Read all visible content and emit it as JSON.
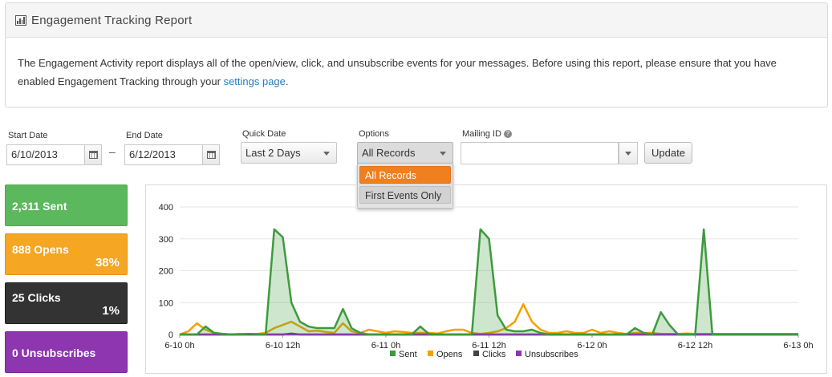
{
  "header": {
    "title": "Engagement Tracking Report",
    "description": "The Engagement Activity report displays all of the open/view, click, and unsubscribe events for your messages. Before using this report, please ensure that you have enabled Engagement Tracking through your ",
    "link_text": "settings page",
    "description_end": "."
  },
  "filters": {
    "start_date_label": "Start Date",
    "start_date_value": "6/10/2013",
    "date_separator": "–",
    "end_date_label": "End Date",
    "end_date_value": "6/12/2013",
    "quick_date_label": "Quick Date",
    "quick_date_value": "Last 2 Days",
    "options_label": "Options",
    "options_value": "All Records",
    "options_items": [
      "All Records",
      "First Events Only"
    ],
    "mailing_id_label": "Mailing ID",
    "mailing_id_help": "?",
    "update_label": "Update"
  },
  "stats": [
    {
      "label": "2,311 Sent",
      "percent": "",
      "color": "#5cb85c"
    },
    {
      "label": "888 Opens",
      "percent": "38%",
      "color": "#f5a623"
    },
    {
      "label": "25 Clicks",
      "percent": "1%",
      "color": "#333333"
    },
    {
      "label": "0 Unsubscribes",
      "percent": "",
      "color": "#8e35b0"
    }
  ],
  "chart_data": {
    "type": "area",
    "x": [
      "6-10 0h",
      "6-10 1h",
      "6-10 2h",
      "6-10 3h",
      "6-10 4h",
      "6-10 5h",
      "6-10 6h",
      "6-10 7h",
      "6-10 8h",
      "6-10 9h",
      "6-10 10h",
      "6-10 11h",
      "6-10 12h",
      "6-10 13h",
      "6-10 14h",
      "6-10 15h",
      "6-10 16h",
      "6-10 17h",
      "6-10 18h",
      "6-10 19h",
      "6-10 20h",
      "6-10 21h",
      "6-10 22h",
      "6-10 23h",
      "6-11 0h",
      "6-11 1h",
      "6-11 2h",
      "6-11 3h",
      "6-11 4h",
      "6-11 5h",
      "6-11 6h",
      "6-11 7h",
      "6-11 8h",
      "6-11 9h",
      "6-11 10h",
      "6-11 11h",
      "6-11 12h",
      "6-11 13h",
      "6-11 14h",
      "6-11 15h",
      "6-11 16h",
      "6-11 17h",
      "6-11 18h",
      "6-11 19h",
      "6-11 20h",
      "6-11 21h",
      "6-11 22h",
      "6-11 23h",
      "6-12 0h",
      "6-12 1h",
      "6-12 2h",
      "6-12 3h",
      "6-12 4h",
      "6-12 5h",
      "6-12 6h",
      "6-12 7h",
      "6-12 8h",
      "6-12 9h",
      "6-12 10h",
      "6-12 11h",
      "6-12 12h",
      "6-12 13h",
      "6-12 14h",
      "6-12 15h",
      "6-12 16h",
      "6-12 17h",
      "6-12 18h",
      "6-12 19h",
      "6-12 20h",
      "6-12 21h",
      "6-12 22h",
      "6-12 23h",
      "6-13 0h"
    ],
    "tick_labels": [
      "6-10 0h",
      "6-10 12h",
      "6-11 0h",
      "6-11 12h",
      "6-12 0h",
      "6-12 12h",
      "6-13 0h"
    ],
    "series": [
      {
        "name": "Sent",
        "color": "#3d9a3d",
        "values": [
          0,
          0,
          0,
          25,
          5,
          2,
          0,
          0,
          2,
          1,
          0,
          330,
          305,
          100,
          40,
          25,
          20,
          20,
          20,
          80,
          20,
          5,
          0,
          0,
          0,
          0,
          0,
          0,
          25,
          2,
          0,
          0,
          0,
          0,
          0,
          330,
          300,
          60,
          15,
          10,
          10,
          15,
          5,
          0,
          0,
          0,
          0,
          0,
          0,
          0,
          0,
          0,
          0,
          20,
          5,
          0,
          70,
          30,
          0,
          0,
          0,
          330,
          0,
          0,
          0,
          0,
          0,
          0,
          0,
          0,
          0,
          0,
          0
        ]
      },
      {
        "name": "Opens",
        "color": "#f5a000",
        "values": [
          0,
          10,
          35,
          15,
          5,
          2,
          0,
          2,
          2,
          2,
          5,
          20,
          30,
          40,
          25,
          10,
          12,
          8,
          5,
          35,
          10,
          5,
          15,
          10,
          5,
          10,
          8,
          5,
          5,
          5,
          3,
          10,
          15,
          15,
          5,
          2,
          5,
          10,
          20,
          40,
          95,
          40,
          15,
          5,
          5,
          10,
          5,
          5,
          15,
          5,
          10,
          5,
          2,
          5,
          5,
          5,
          2,
          2,
          2,
          3,
          2,
          2,
          2,
          2,
          2,
          2,
          2,
          2,
          2,
          2,
          2,
          2,
          2
        ]
      },
      {
        "name": "Clicks",
        "color": "#444444",
        "values": [
          0,
          0,
          0,
          0,
          0,
          0,
          0,
          0,
          0,
          0,
          0,
          0,
          0,
          3,
          0,
          0,
          0,
          0,
          0,
          0,
          0,
          0,
          0,
          0,
          0,
          0,
          0,
          0,
          0,
          0,
          0,
          0,
          0,
          0,
          0,
          0,
          0,
          0,
          0,
          0,
          0,
          0,
          0,
          0,
          0,
          0,
          0,
          0,
          0,
          0,
          0,
          0,
          0,
          0,
          0,
          0,
          0,
          0,
          0,
          0,
          0,
          0,
          0,
          0,
          0,
          0,
          0,
          0,
          0,
          0,
          0,
          0,
          0
        ]
      },
      {
        "name": "Unsubscribes",
        "color": "#8e35b0",
        "values": [
          0,
          0,
          0,
          0,
          0,
          0,
          0,
          0,
          0,
          0,
          0,
          0,
          0,
          0,
          0,
          0,
          0,
          0,
          0,
          0,
          0,
          0,
          0,
          0,
          0,
          0,
          0,
          0,
          0,
          0,
          0,
          0,
          0,
          0,
          0,
          0,
          0,
          0,
          0,
          0,
          0,
          0,
          0,
          0,
          0,
          0,
          0,
          0,
          0,
          0,
          0,
          0,
          0,
          0,
          0,
          0,
          0,
          0,
          0,
          0,
          0,
          0,
          0,
          0,
          0,
          0,
          0,
          0,
          0,
          0,
          0,
          0,
          0
        ]
      }
    ],
    "yticks": [
      "0",
      "100",
      "200",
      "300",
      "400"
    ],
    "ylim": [
      0,
      400
    ],
    "grid": true,
    "legend": "bottom"
  }
}
